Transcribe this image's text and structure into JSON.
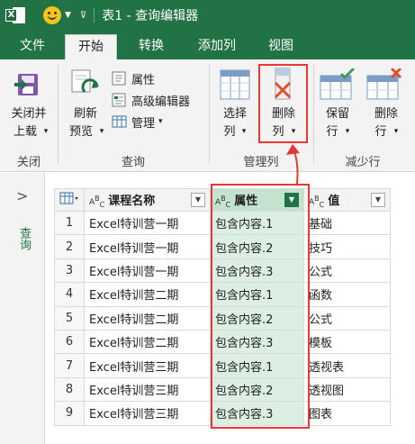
{
  "titlebar": {
    "app_logo": "X",
    "title": "表1 - 查询编辑器",
    "bg_color": "#217346"
  },
  "tabs": [
    {
      "label": "文件"
    },
    {
      "label": "开始"
    },
    {
      "label": "转换"
    },
    {
      "label": "添加列"
    },
    {
      "label": "视图"
    }
  ],
  "ribbon": {
    "close_load_line1": "关闭并",
    "close_load_line2": "上载",
    "refresh_line1": "刷新",
    "refresh_line2": "预览",
    "properties": "属性",
    "advanced_editor": "高级编辑器",
    "manage": "管理",
    "choose_columns_line1": "选择",
    "choose_columns_line2": "列",
    "remove_columns_line1": "删除",
    "remove_columns_line2": "列",
    "keep_rows_line1": "保留",
    "keep_rows_line2": "行",
    "remove_rows_line1": "删除",
    "remove_rows_line2": "行",
    "groups": {
      "close": "关闭",
      "query": "查询",
      "manage_columns": "管理列",
      "reduce_rows": "减少行"
    },
    "highlight_color": "#e53935"
  },
  "left_pane": {
    "expand_icon": "chevron-right-icon",
    "label": "查询"
  },
  "table": {
    "headers": {
      "course": "课程名称",
      "attribute": "属性",
      "value": "值"
    },
    "rows": [
      {
        "idx": "1",
        "course": "Excel特训营一期",
        "attribute": "包含内容.1",
        "value": "基础"
      },
      {
        "idx": "2",
        "course": "Excel特训营一期",
        "attribute": "包含内容.2",
        "value": "技巧"
      },
      {
        "idx": "3",
        "course": "Excel特训营一期",
        "attribute": "包含内容.3",
        "value": "公式"
      },
      {
        "idx": "4",
        "course": "Excel特训营二期",
        "attribute": "包含内容.1",
        "value": "函数"
      },
      {
        "idx": "5",
        "course": "Excel特训营二期",
        "attribute": "包含内容.2",
        "value": "公式"
      },
      {
        "idx": "6",
        "course": "Excel特训营二期",
        "attribute": "包含内容.3",
        "value": "模板"
      },
      {
        "idx": "7",
        "course": "Excel特训营三期",
        "attribute": "包含内容.1",
        "value": "透视表"
      },
      {
        "idx": "8",
        "course": "Excel特训营三期",
        "attribute": "包含内容.2",
        "value": "透视图"
      },
      {
        "idx": "9",
        "course": "Excel特训营三期",
        "attribute": "包含内容.3",
        "value": "图表"
      }
    ],
    "selected_column_color": "#dcefe3"
  }
}
